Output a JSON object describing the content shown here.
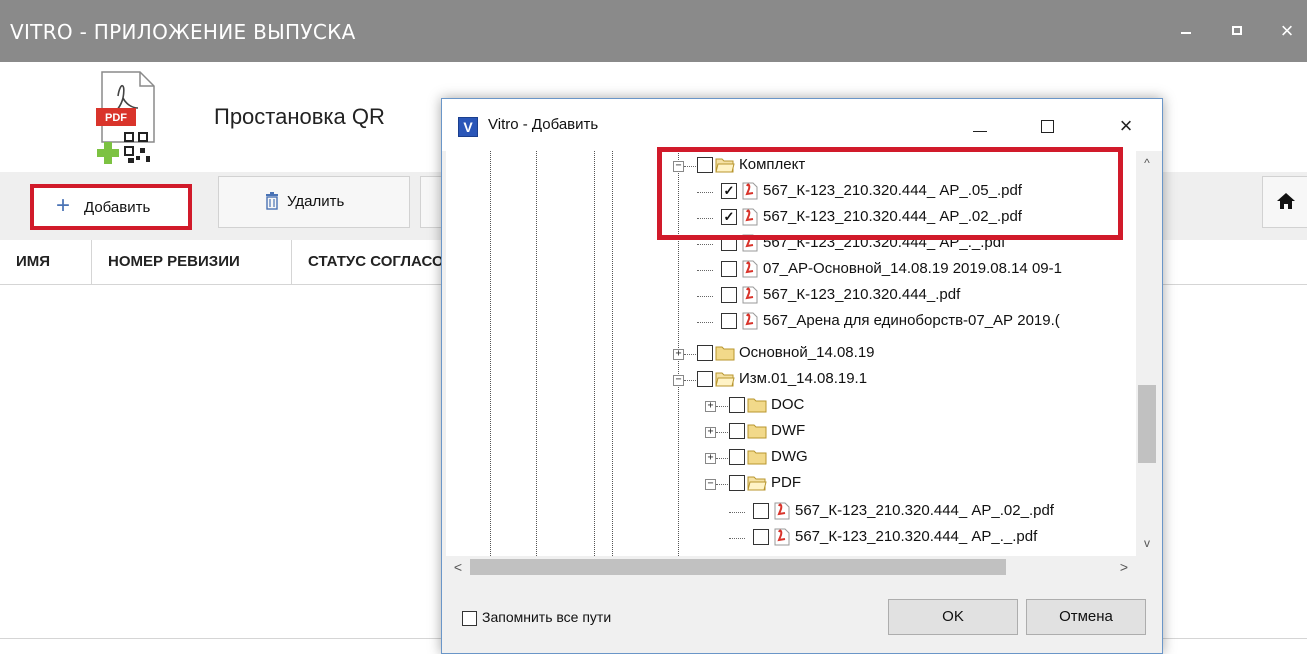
{
  "window": {
    "title": "VITRO - ПРИЛОЖЕНИЕ ВЫПУСКА",
    "controls": {
      "minimize": "minimize-icon",
      "maximize": "maximize-icon",
      "close": "×"
    }
  },
  "header": {
    "heading": "Простановка QR"
  },
  "toolbar": {
    "add_icon": "+",
    "add_label": "Добавить",
    "delete_label": "Удалить"
  },
  "table": {
    "columns": [
      "ИМЯ",
      "НОМЕР РЕВИЗИИ",
      "СТАТУС СОГЛАСОВАНИЯ"
    ]
  },
  "dialog": {
    "title": "Vitro - Добавить",
    "logo": "V",
    "close": "×",
    "tree": [
      {
        "label": "Комплект",
        "type": "folder-open",
        "expander": "−",
        "checked": false
      },
      {
        "label": "567_К-123_210.320.444_ АР_.05_.pdf",
        "type": "pdf",
        "checked": true
      },
      {
        "label": "567_К-123_210.320.444_ АР_.02_.pdf",
        "type": "pdf",
        "checked": true
      },
      {
        "label": "567_К-123_210.320.444_ АР_._.pdf",
        "type": "pdf",
        "checked": false
      },
      {
        "label": "07_АР-Основной_14.08.19 2019.08.14 09-1",
        "type": "pdf",
        "checked": false
      },
      {
        "label": "567_К-123_210.320.444_.pdf",
        "type": "pdf",
        "checked": false
      },
      {
        "label": "567_Арена для единоборств-07_АР 2019.(",
        "type": "pdf",
        "checked": false
      },
      {
        "label": "Основной_14.08.19",
        "type": "folder",
        "expander": "+",
        "checked": false
      },
      {
        "label": "Изм.01_14.08.19.1",
        "type": "folder-open",
        "expander": "−",
        "checked": false
      },
      {
        "label": "DOC",
        "type": "folder",
        "expander": "+",
        "checked": false
      },
      {
        "label": "DWF",
        "type": "folder",
        "expander": "+",
        "checked": false
      },
      {
        "label": "DWG",
        "type": "folder",
        "expander": "+",
        "checked": false
      },
      {
        "label": "PDF",
        "type": "folder-open",
        "expander": "−",
        "checked": false
      },
      {
        "label": "567_К-123_210.320.444_ АР_.02_.pdf",
        "type": "pdf",
        "checked": false
      },
      {
        "label": "567_К-123_210.320.444_ АР_._.pdf",
        "type": "pdf",
        "checked": false
      }
    ],
    "scroll_up": "^",
    "scroll_down": "v",
    "scroll_left": "<",
    "scroll_right": ">",
    "remember_label": "Запомнить все пути",
    "ok_label": "OK",
    "cancel_label": "Отмена"
  },
  "colors": {
    "highlight": "#d11a2a",
    "titlebar": "#8a8a8a",
    "add_icon": "#4a73b5"
  }
}
